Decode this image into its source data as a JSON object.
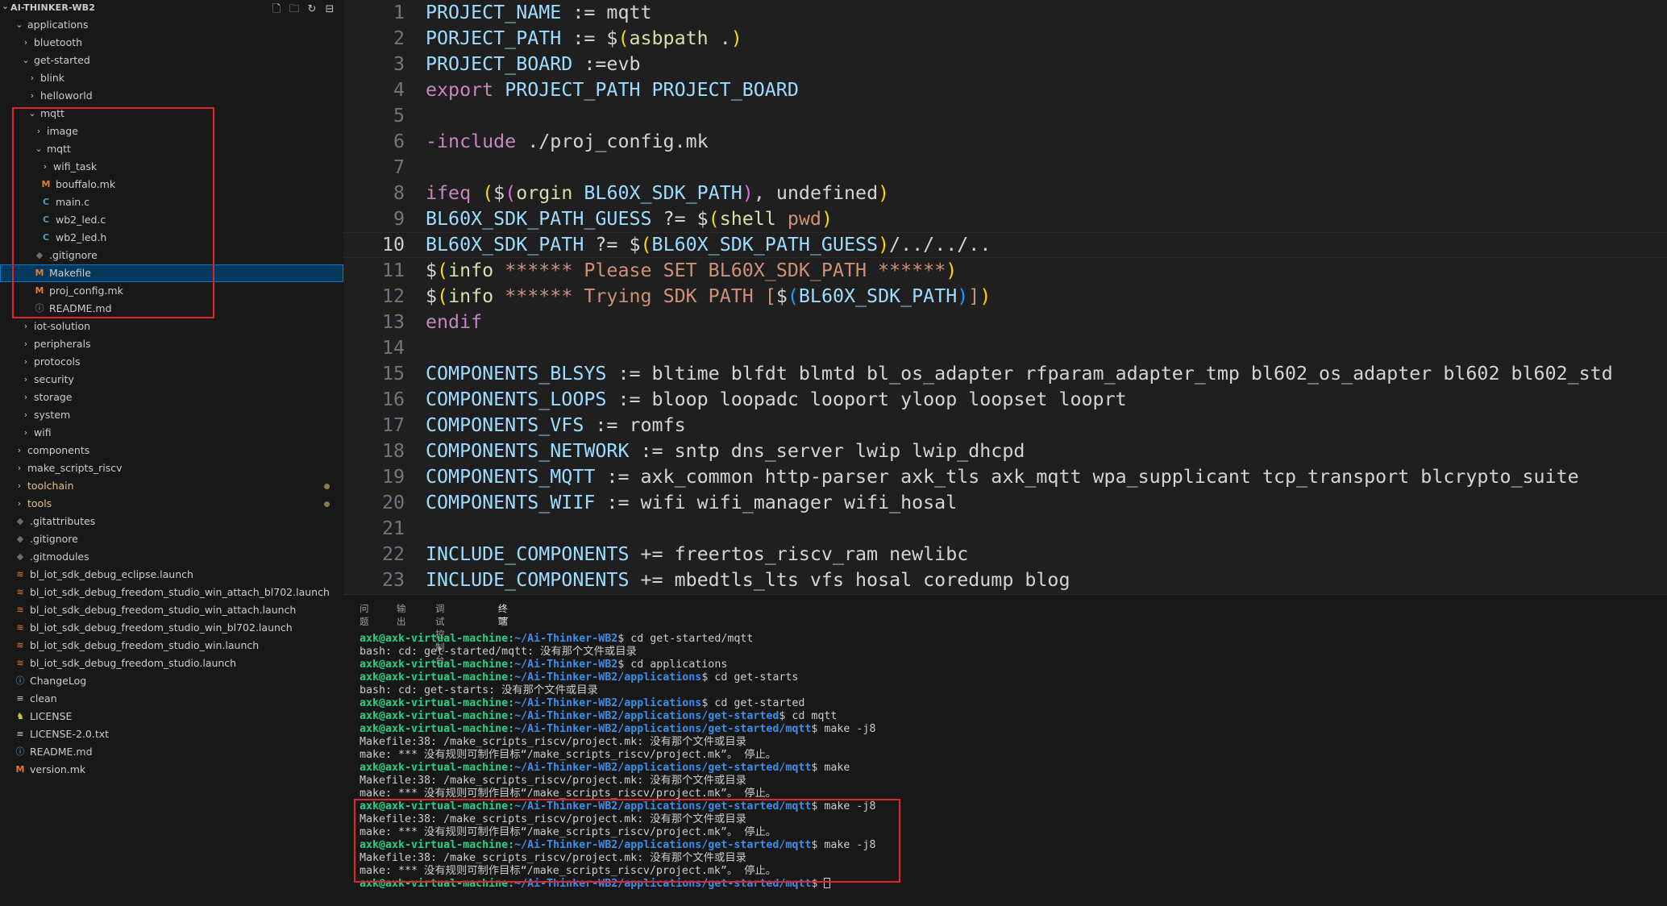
{
  "explorer": {
    "title": "AI-THINKER-WB2",
    "actions": [
      {
        "name": "new-file-icon",
        "glyph": "🗋"
      },
      {
        "name": "new-folder-icon",
        "glyph": "🗀"
      },
      {
        "name": "refresh-icon",
        "glyph": "↻"
      },
      {
        "name": "collapse-all-icon",
        "glyph": "⊟"
      }
    ],
    "tree": [
      {
        "label": "applications",
        "depth": 0,
        "type": "folder",
        "open": true
      },
      {
        "label": "bluetooth",
        "depth": 1,
        "type": "folder",
        "open": false
      },
      {
        "label": "get-started",
        "depth": 1,
        "type": "folder",
        "open": true
      },
      {
        "label": "blink",
        "depth": 2,
        "type": "folder",
        "open": false
      },
      {
        "label": "helloworld",
        "depth": 2,
        "type": "folder",
        "open": false
      },
      {
        "label": "mqtt",
        "depth": 2,
        "type": "folder",
        "open": true
      },
      {
        "label": "image",
        "depth": 3,
        "type": "folder",
        "open": false
      },
      {
        "label": "mqtt",
        "depth": 3,
        "type": "folder",
        "open": true
      },
      {
        "label": "wifi_task",
        "depth": 4,
        "type": "folder",
        "open": false
      },
      {
        "label": "bouffalo.mk",
        "depth": 4,
        "type": "file",
        "icon": "m"
      },
      {
        "label": "main.c",
        "depth": 4,
        "type": "file",
        "icon": "c"
      },
      {
        "label": "wb2_led.c",
        "depth": 4,
        "type": "file",
        "icon": "c"
      },
      {
        "label": "wb2_led.h",
        "depth": 4,
        "type": "file",
        "icon": "c"
      },
      {
        "label": ".gitignore",
        "depth": 3,
        "type": "file",
        "icon": "git"
      },
      {
        "label": "Makefile",
        "depth": 3,
        "type": "file",
        "icon": "m",
        "selected": true
      },
      {
        "label": "proj_config.mk",
        "depth": 3,
        "type": "file",
        "icon": "m"
      },
      {
        "label": "README.md",
        "depth": 3,
        "type": "file",
        "icon": "info"
      },
      {
        "label": "iot-solution",
        "depth": 1,
        "type": "folder",
        "open": false
      },
      {
        "label": "peripherals",
        "depth": 1,
        "type": "folder",
        "open": false
      },
      {
        "label": "protocols",
        "depth": 1,
        "type": "folder",
        "open": false
      },
      {
        "label": "security",
        "depth": 1,
        "type": "folder",
        "open": false
      },
      {
        "label": "storage",
        "depth": 1,
        "type": "folder",
        "open": false
      },
      {
        "label": "system",
        "depth": 1,
        "type": "folder",
        "open": false
      },
      {
        "label": "wifi",
        "depth": 1,
        "type": "folder",
        "open": false
      },
      {
        "label": "components",
        "depth": 0,
        "type": "folder",
        "open": false
      },
      {
        "label": "make_scripts_riscv",
        "depth": 0,
        "type": "folder",
        "open": false
      },
      {
        "label": "toolchain",
        "depth": 0,
        "type": "folder",
        "open": false,
        "modified": true
      },
      {
        "label": "tools",
        "depth": 0,
        "type": "folder",
        "open": false,
        "modified": true
      },
      {
        "label": ".gitattributes",
        "depth": 0,
        "type": "file",
        "icon": "git"
      },
      {
        "label": ".gitignore",
        "depth": 0,
        "type": "file",
        "icon": "git"
      },
      {
        "label": ".gitmodules",
        "depth": 0,
        "type": "file",
        "icon": "git"
      },
      {
        "label": "bl_iot_sdk_debug_eclipse.launch",
        "depth": 0,
        "type": "file",
        "icon": "rss"
      },
      {
        "label": "bl_iot_sdk_debug_freedom_studio_win_attach_bl702.launch",
        "depth": 0,
        "type": "file",
        "icon": "rss"
      },
      {
        "label": "bl_iot_sdk_debug_freedom_studio_win_attach.launch",
        "depth": 0,
        "type": "file",
        "icon": "rss"
      },
      {
        "label": "bl_iot_sdk_debug_freedom_studio_win_bl702.launch",
        "depth": 0,
        "type": "file",
        "icon": "rss"
      },
      {
        "label": "bl_iot_sdk_debug_freedom_studio_win.launch",
        "depth": 0,
        "type": "file",
        "icon": "rss"
      },
      {
        "label": "bl_iot_sdk_debug_freedom_studio.launch",
        "depth": 0,
        "type": "file",
        "icon": "rss"
      },
      {
        "label": "ChangeLog",
        "depth": 0,
        "type": "file",
        "icon": "info"
      },
      {
        "label": "clean",
        "depth": 0,
        "type": "file",
        "icon": "eq"
      },
      {
        "label": "LICENSE",
        "depth": 0,
        "type": "file",
        "icon": "lic"
      },
      {
        "label": "LICENSE-2.0.txt",
        "depth": 0,
        "type": "file",
        "icon": "eq"
      },
      {
        "label": "README.md",
        "depth": 0,
        "type": "file",
        "icon": "info"
      },
      {
        "label": "version.mk",
        "depth": 0,
        "type": "file",
        "icon": "m"
      }
    ]
  },
  "editor": {
    "current_line": 10,
    "lines": [
      [
        [
          "var",
          "PROJECT_NAME"
        ],
        [
          "op",
          " := "
        ],
        [
          "txt",
          "mqtt"
        ]
      ],
      [
        [
          "var",
          "PORJECT_PATH"
        ],
        [
          "op",
          " := "
        ],
        [
          "op",
          "$"
        ],
        [
          "b1",
          "("
        ],
        [
          "fn",
          "asbpath"
        ],
        [
          "txt",
          " ."
        ],
        [
          "b1",
          ")"
        ]
      ],
      [
        [
          "var",
          "PROJECT_BOARD"
        ],
        [
          "op",
          " :="
        ],
        [
          "txt",
          "evb"
        ]
      ],
      [
        [
          "key",
          "export"
        ],
        [
          "txt",
          " "
        ],
        [
          "var",
          "PROJECT_PATH PROJECT_BOARD"
        ]
      ],
      [],
      [
        [
          "key",
          "-include"
        ],
        [
          "txt",
          " ./proj_config.mk"
        ]
      ],
      [],
      [
        [
          "key",
          "ifeq"
        ],
        [
          "txt",
          " "
        ],
        [
          "b1",
          "("
        ],
        [
          "op",
          "$"
        ],
        [
          "b2",
          "("
        ],
        [
          "fn",
          "orgin"
        ],
        [
          "txt",
          " "
        ],
        [
          "var",
          "BL60X_SDK_PATH"
        ],
        [
          "b2",
          ")"
        ],
        [
          "txt",
          ", undefined"
        ],
        [
          "b1",
          ")"
        ]
      ],
      [
        [
          "var",
          "BL60X_SDK_PATH_GUESS"
        ],
        [
          "op",
          " ?= "
        ],
        [
          "op",
          "$"
        ],
        [
          "b1",
          "("
        ],
        [
          "fn",
          "shell"
        ],
        [
          "txt",
          " "
        ],
        [
          "str",
          "pwd"
        ],
        [
          "b1",
          ")"
        ]
      ],
      [
        [
          "var",
          "BL60X_SDK_PATH"
        ],
        [
          "op",
          " ?= "
        ],
        [
          "op",
          "$"
        ],
        [
          "b1",
          "("
        ],
        [
          "var",
          "BL60X_SDK_PATH_GUESS"
        ],
        [
          "b1",
          ")"
        ],
        [
          "txt",
          "/../../.."
        ]
      ],
      [
        [
          "op",
          "$"
        ],
        [
          "b1",
          "("
        ],
        [
          "fn",
          "info"
        ],
        [
          "txt",
          " "
        ],
        [
          "str",
          "****** Please SET BL60X_SDK_PATH ******"
        ],
        [
          "b1",
          ")"
        ]
      ],
      [
        [
          "op",
          "$"
        ],
        [
          "b1",
          "("
        ],
        [
          "fn",
          "info"
        ],
        [
          "txt",
          " "
        ],
        [
          "str",
          "****** Trying SDK PATH ["
        ],
        [
          "op",
          "$"
        ],
        [
          "b3",
          "("
        ],
        [
          "var",
          "BL60X_SDK_PATH"
        ],
        [
          "b3",
          ")"
        ],
        [
          "str",
          "]"
        ],
        [
          "b1",
          ")"
        ]
      ],
      [
        [
          "key",
          "endif"
        ]
      ],
      [],
      [
        [
          "var",
          "COMPONENTS_BLSYS"
        ],
        [
          "op",
          " := "
        ],
        [
          "txt",
          "bltime blfdt blmtd bl_os_adapter rfparam_adapter_tmp bl602_os_adapter bl602 bl602_std"
        ]
      ],
      [
        [
          "var",
          "COMPONENTS_LOOPS"
        ],
        [
          "op",
          " := "
        ],
        [
          "txt",
          "bloop loopadc looport yloop loopset looprt"
        ]
      ],
      [
        [
          "var",
          "COMPONENTS_VFS"
        ],
        [
          "op",
          " := "
        ],
        [
          "txt",
          "romfs"
        ]
      ],
      [
        [
          "var",
          "COMPONENTS_NETWORK"
        ],
        [
          "op",
          " := "
        ],
        [
          "txt",
          "sntp dns_server lwip lwip_dhcpd"
        ]
      ],
      [
        [
          "var",
          "COMPONENTS_MQTT"
        ],
        [
          "op",
          " := "
        ],
        [
          "txt",
          "axk_common http-parser axk_tls axk_mqtt wpa_supplicant tcp_transport blcrypto_suite"
        ]
      ],
      [
        [
          "var",
          "COMPONENTS_WIIF"
        ],
        [
          "op",
          " := "
        ],
        [
          "txt",
          "wifi wifi_manager wifi_hosal"
        ]
      ],
      [],
      [
        [
          "var",
          "INCLUDE_COMPONENTS"
        ],
        [
          "op",
          " += "
        ],
        [
          "txt",
          "freertos_riscv_ram newlibc"
        ]
      ],
      [
        [
          "var",
          "INCLUDE_COMPONENTS"
        ],
        [
          "op",
          " += "
        ],
        [
          "txt",
          "mbedtls_lts vfs hosal coredump blog"
        ]
      ]
    ]
  },
  "panel": {
    "tabs": [
      "问题",
      "输出",
      "调试控制台",
      "终端"
    ],
    "active_tab": 3,
    "terminal": [
      {
        "user": "axk@axk-virtual-machine",
        "path": "~/Ai-Thinker-WB2",
        "cmd": "$ cd get-started/mqtt"
      },
      {
        "text": "bash: cd: get-started/mqtt: 没有那个文件或目录"
      },
      {
        "user": "axk@axk-virtual-machine",
        "path": "~/Ai-Thinker-WB2",
        "cmd": "$ cd applications"
      },
      {
        "user": "axk@axk-virtual-machine",
        "path": "~/Ai-Thinker-WB2/applications",
        "cmd": "$ cd get-starts"
      },
      {
        "text": "bash: cd: get-starts: 没有那个文件或目录"
      },
      {
        "user": "axk@axk-virtual-machine",
        "path": "~/Ai-Thinker-WB2/applications",
        "cmd": "$ cd get-started"
      },
      {
        "user": "axk@axk-virtual-machine",
        "path": "~/Ai-Thinker-WB2/applications/get-started",
        "cmd": "$ cd mqtt"
      },
      {
        "user": "axk@axk-virtual-machine",
        "path": "~/Ai-Thinker-WB2/applications/get-started/mqtt",
        "cmd": "$ make -j8"
      },
      {
        "text": "Makefile:38: /make_scripts_riscv/project.mk: 没有那个文件或目录"
      },
      {
        "text": "make: *** 没有规则可制作目标“/make_scripts_riscv/project.mk”。 停止。"
      },
      {
        "user": "axk@axk-virtual-machine",
        "path": "~/Ai-Thinker-WB2/applications/get-started/mqtt",
        "cmd": "$ make"
      },
      {
        "text": "Makefile:38: /make_scripts_riscv/project.mk: 没有那个文件或目录"
      },
      {
        "text": "make: *** 没有规则可制作目标“/make_scripts_riscv/project.mk”。 停止。"
      },
      {
        "user": "axk@axk-virtual-machine",
        "path": "~/Ai-Thinker-WB2/applications/get-started/mqtt",
        "cmd": "$ make -j8"
      },
      {
        "text": "Makefile:38: /make_scripts_riscv/project.mk: 没有那个文件或目录"
      },
      {
        "text": "make: *** 没有规则可制作目标“/make_scripts_riscv/project.mk”。 停止。"
      },
      {
        "user": "axk@axk-virtual-machine",
        "path": "~/Ai-Thinker-WB2/applications/get-started/mqtt",
        "cmd": "$ make -j8"
      },
      {
        "text": "Makefile:38: /make_scripts_riscv/project.mk: 没有那个文件或目录"
      },
      {
        "text": "make: *** 没有规则可制作目标“/make_scripts_riscv/project.mk”。 停止。"
      },
      {
        "user": "axk@axk-virtual-machine",
        "path": "~/Ai-Thinker-WB2/applications/get-started/mqtt",
        "cmd": "$ ",
        "cursor": true
      }
    ]
  },
  "colors": {
    "highlight_box": "#e0242f",
    "selection": "#04395e"
  }
}
